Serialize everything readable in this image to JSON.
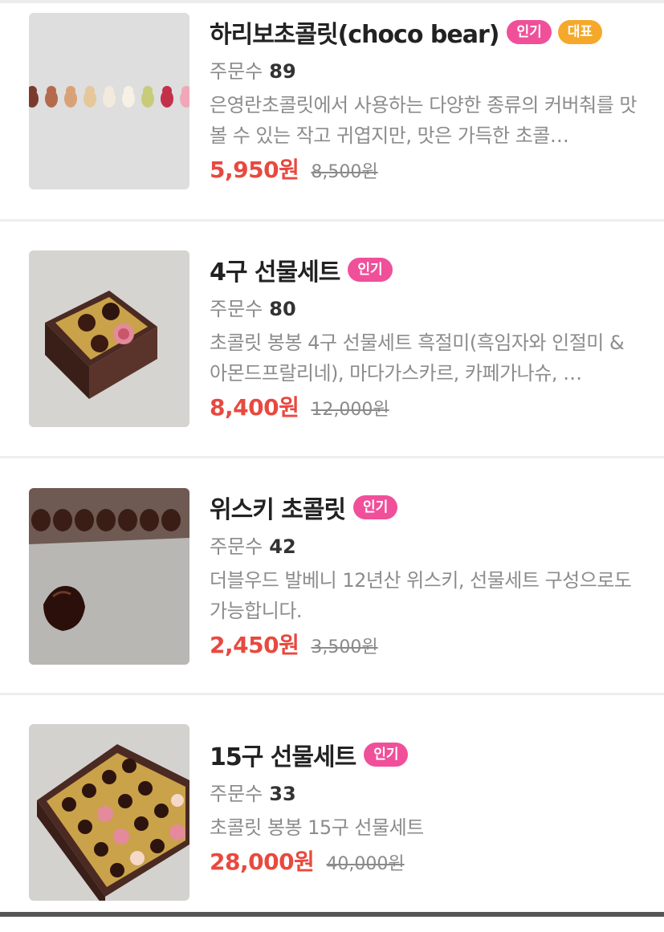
{
  "colors": {
    "accent_price": "#e8493f",
    "badge_popular": "#f0509a",
    "badge_representative": "#f5a82a"
  },
  "orders_label": "주문수",
  "products": [
    {
      "title": "하리보초콜릿(choco bear)",
      "badges": [
        "인기",
        "대표"
      ],
      "orders": "89",
      "description": "은영란초콜릿에서 사용하는 다양한 종류의 커버춰를 맛볼 수 있는 작고 귀엽지만, 맛은 가득한 초콜…",
      "price": "5,950원",
      "original_price": "8,500원"
    },
    {
      "title": "4구 선물세트",
      "badges": [
        "인기"
      ],
      "orders": "80",
      "description": "초콜릿 봉봉 4구 선물세트 흑절미(흑임자와 인절미 & 아몬드프랄리네), 마다가스카르, 카페가나슈, …",
      "price": "8,400원",
      "original_price": "12,000원"
    },
    {
      "title": "위스키 초콜릿",
      "badges": [
        "인기"
      ],
      "orders": "42",
      "description": "더블우드 발베니 12년산 위스키, 선물세트 구성으로도 가능합니다.",
      "price": "2,450원",
      "original_price": "3,500원"
    },
    {
      "title": "15구 선물세트",
      "badges": [
        "인기"
      ],
      "orders": "33",
      "description": "초콜릿 봉봉 15구 선물세트",
      "price": "28,000원",
      "original_price": "40,000원"
    }
  ]
}
